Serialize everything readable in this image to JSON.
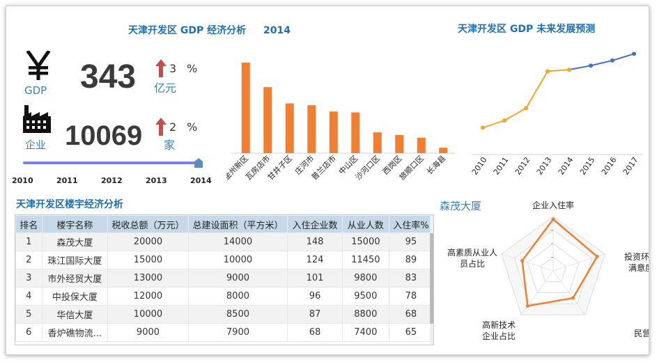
{
  "colors": {
    "accent_orange": "#ef7f32",
    "accent_blue": "#1f6fb2",
    "forecast_blue": "#4472c4",
    "arrow_red": "#c0504d"
  },
  "overview": {
    "title": "天津开发区 GDP 经济分析",
    "year": "2014",
    "gdp": {
      "icon": "yen-icon",
      "label": "GDP",
      "value": "343",
      "change": "3",
      "pct": "%",
      "unit": "亿元"
    },
    "companies": {
      "icon": "factory-icon",
      "label": "企业",
      "value": "10069",
      "change": "2",
      "pct": "%",
      "unit": "家"
    },
    "timeline": {
      "years": [
        "2010",
        "2011",
        "2012",
        "2013",
        "2014"
      ],
      "selected": "2014",
      "progress": 1.0
    }
  },
  "district_chart": {
    "chart_data": {
      "type": "bar",
      "categories": [
        "金州新区",
        "瓦房店市",
        "甘井子区",
        "庄河市",
        "普兰店市",
        "中山区",
        "沙河口区",
        "西岗区",
        "旅顺口区",
        "长海县"
      ],
      "values": [
        100,
        73,
        55,
        53,
        46,
        45,
        23,
        20,
        17,
        6
      ],
      "ylim": [
        0,
        100
      ]
    }
  },
  "forecast": {
    "title": "天津开发区 GDP 未来发展预测",
    "chart_data": {
      "type": "line",
      "x": [
        "2010",
        "2011",
        "2012",
        "2013",
        "2014",
        "2015",
        "2016",
        "2017"
      ],
      "series": [
        {
          "values": [
            212,
            226,
            250,
            322,
            325,
            333,
            343,
            356
          ]
        }
      ],
      "actual_until": "2014",
      "ylim": [
        180,
        370
      ]
    }
  },
  "buildings": {
    "title": "天津开发区楼宇经济分析",
    "columns": [
      "排名",
      "楼宇名称",
      "税收总额（万元）",
      "总建设面积（平方米）",
      "入住企业数",
      "从业人数",
      "入住率%"
    ],
    "rows": [
      [
        "1",
        "森茂大厦",
        "20000",
        "14000",
        "148",
        "15000",
        "95"
      ],
      [
        "2",
        "珠江国际大厦",
        "15000",
        "10000",
        "124",
        "11450",
        "89"
      ],
      [
        "3",
        "市外经贸大厦",
        "13000",
        "9000",
        "101",
        "9800",
        "83"
      ],
      [
        "4",
        "中投保大厦",
        "12000",
        "8000",
        "96",
        "9500",
        "78"
      ],
      [
        "5",
        "华信大厦",
        "10000",
        "8500",
        "87",
        "8800",
        "68"
      ],
      [
        "6",
        "香炉礁物流...",
        "9000",
        "7900",
        "68",
        "7400",
        "65"
      ]
    ]
  },
  "radar": {
    "building_name": "森茂大厦",
    "chart_data": {
      "type": "radar",
      "axes": [
        "企业入住率",
        "投资环境满意度",
        "民营占比",
        "高新技术企业占比",
        "高素质从业人员占比"
      ],
      "values": [
        0.95,
        0.85,
        0.62,
        0.8,
        0.6
      ],
      "range": [
        0,
        1
      ]
    }
  }
}
